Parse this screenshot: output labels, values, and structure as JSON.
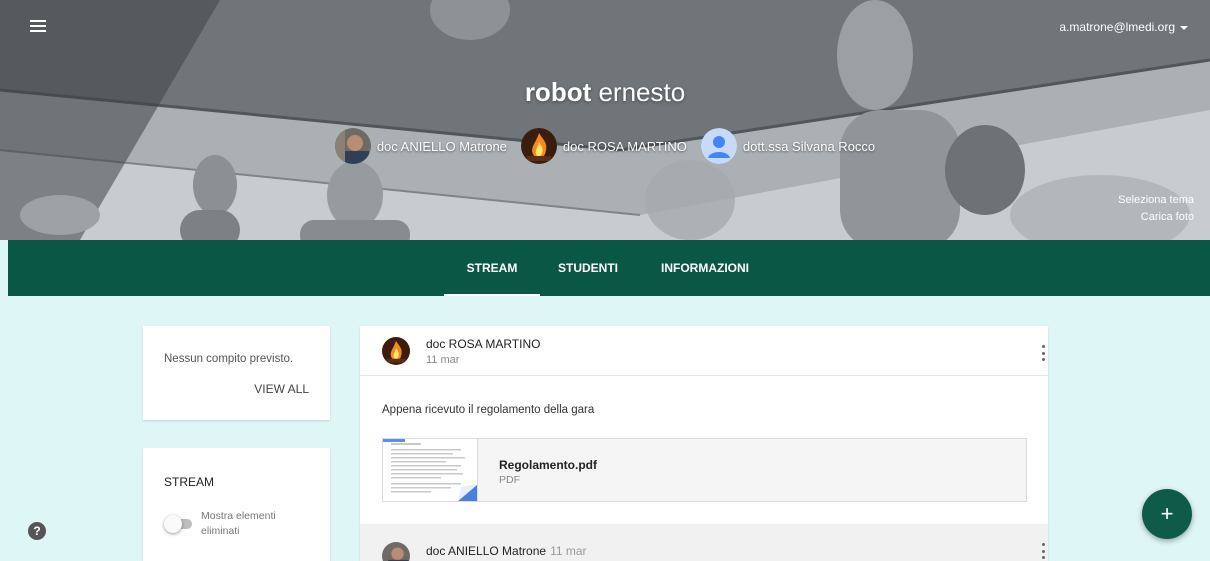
{
  "header": {
    "account_email": "a.matrone@lmedi.org",
    "class_title_bold": "robot",
    "class_title_rest": " ernesto",
    "teachers": [
      {
        "name": "doc ANIELLO Matrone",
        "avatar": "photo-avatar"
      },
      {
        "name": "doc ROSA MARTINO",
        "avatar": "fire-avatar"
      },
      {
        "name": "dott.ssa Silvana Rocco",
        "avatar": "default-person-avatar"
      }
    ],
    "select_theme": "Seleziona tema",
    "upload_photo": "Carica foto"
  },
  "tabs": [
    {
      "label": "STREAM",
      "active": true
    },
    {
      "label": "STUDENTI",
      "active": false
    },
    {
      "label": "INFORMAZIONI",
      "active": false
    }
  ],
  "upcoming": {
    "message": "Nessun compito previsto.",
    "view_all": "VIEW ALL"
  },
  "stream_settings": {
    "title": "STREAM",
    "toggle_label": "Mostra elementi eliminati",
    "toggle_on": false
  },
  "posts": [
    {
      "author": "doc ROSA MARTINO",
      "date": "11 mar",
      "text": "Appena ricevuto il regolamento della gara",
      "attachment": {
        "name": "Regolamento.pdf",
        "type": "PDF"
      }
    },
    {
      "author": "doc ANIELLO Matrone",
      "date": "11 mar"
    }
  ],
  "fab_label": "+",
  "help_label": "?",
  "colors": {
    "tab_bar": "#0b5746",
    "page_bg": "#dff6f7",
    "fab": "#0f5b4a"
  }
}
